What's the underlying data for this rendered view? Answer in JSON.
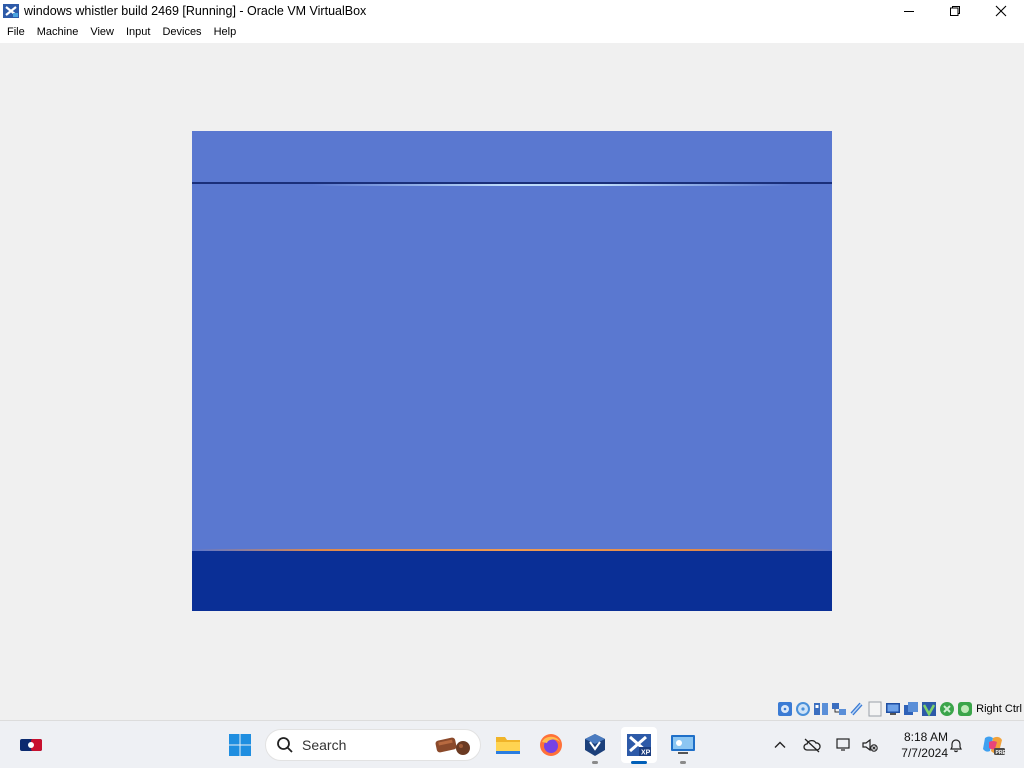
{
  "window": {
    "title": "windows whistler build 2469 [Running] - Oracle VM VirtualBox"
  },
  "menu": {
    "items": [
      "File",
      "Machine",
      "View",
      "Input",
      "Devices",
      "Help"
    ]
  },
  "status_bar": {
    "host_key": "Right Ctrl",
    "icons": [
      "hard-disk-icon",
      "optical-drive-icon",
      "audio-icon",
      "network-icon",
      "usb-icon",
      "shared-folders-icon",
      "display-icon",
      "video-capture-icon",
      "virtualization-icon",
      "mouse-integration-icon",
      "cpu-icon"
    ]
  },
  "taskbar": {
    "search_placeholder": "Search",
    "apps": [
      "start-icon",
      "file-explorer-icon",
      "firefox-icon",
      "virtualbox-icon",
      "windows-xp-vm-icon",
      "remote-desktop-icon"
    ],
    "time": "8:18 AM",
    "date": "7/7/2024"
  },
  "colors": {
    "vm_background": "#5a78d0",
    "vm_taskbar": "#0a2f96",
    "accent": "#005fb8"
  }
}
